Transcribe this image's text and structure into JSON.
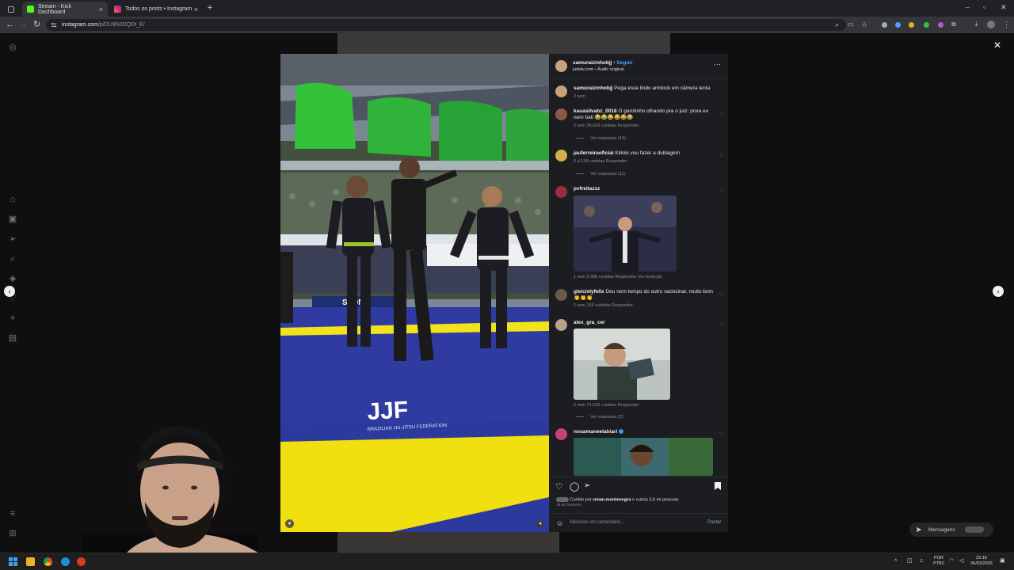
{
  "browser": {
    "tabs": [
      {
        "label": "Stream - Kick Dashboard",
        "active": true,
        "color": "#53fc18"
      },
      {
        "label": "Todos os posts • Instagram",
        "active": false,
        "color": "#e1306c"
      }
    ],
    "url_host": "instagram.com",
    "url_path": "/p/DU9NJOQDt_E/"
  },
  "post": {
    "author": "samuraizinhobjj",
    "follow_label": "Seguir",
    "subtitle": "judotv.com • Áudio original",
    "caption_user": "samuraizinhobjj",
    "caption_text": "Pega esse lindo armlock em câmera lenta",
    "caption_time": "2 sem"
  },
  "comments": [
    {
      "user": "kauasilvabz_0018",
      "text": "O garotinho olhando pra o juiz: poxa eu nem bati 😂😂😂😂😂😂",
      "meta": "2 sem   36.629 curtidas   Responder",
      "replies": "Ver respostas (14)"
    },
    {
      "user": "jauferreiraoficial",
      "text": "Kkkkk vou fazer a dublagem",
      "meta": "6 d   138 curtidas   Responder",
      "replies": "Ver respostas (11)"
    },
    {
      "user": "pvfreitazzz",
      "text": "",
      "meta": "1 sem   5.988 curtidas   Responder   Ver tradução",
      "replies": ""
    },
    {
      "user": "gleicielyfelix",
      "text": "Deu nem tempo do outro raciocinar, muito bom 👏👏👏",
      "meta": "1 sem   159 curtidas   Responder",
      "replies": ""
    },
    {
      "user": "alex_gra_cer",
      "text": "",
      "meta": "2 sem   71.525 curtidas   Responder",
      "replies": "Ver respostas (2)"
    },
    {
      "user": "nouamaneelabiari",
      "text": "",
      "meta": "",
      "replies": ""
    }
  ],
  "likes": {
    "text_prefix": "Curtido por",
    "liker": "renan.montenegro",
    "text_suffix": "e outras 2,6 mi pessoas",
    "date": "19 de fevereiro"
  },
  "comment_input": {
    "placeholder": "Adicione um comentário...",
    "post_label": "Postar"
  },
  "video": {
    "mat_text": "JJF",
    "mat_subtext": "BRAZILIAN JIU-JITSU FEDERATION",
    "banner_text": "STONE"
  },
  "dm": {
    "label": "Mensagens"
  },
  "taskbar": {
    "lang": "POR",
    "lang2": "PTB2",
    "time": "23:16",
    "date": "06/03/2026"
  }
}
